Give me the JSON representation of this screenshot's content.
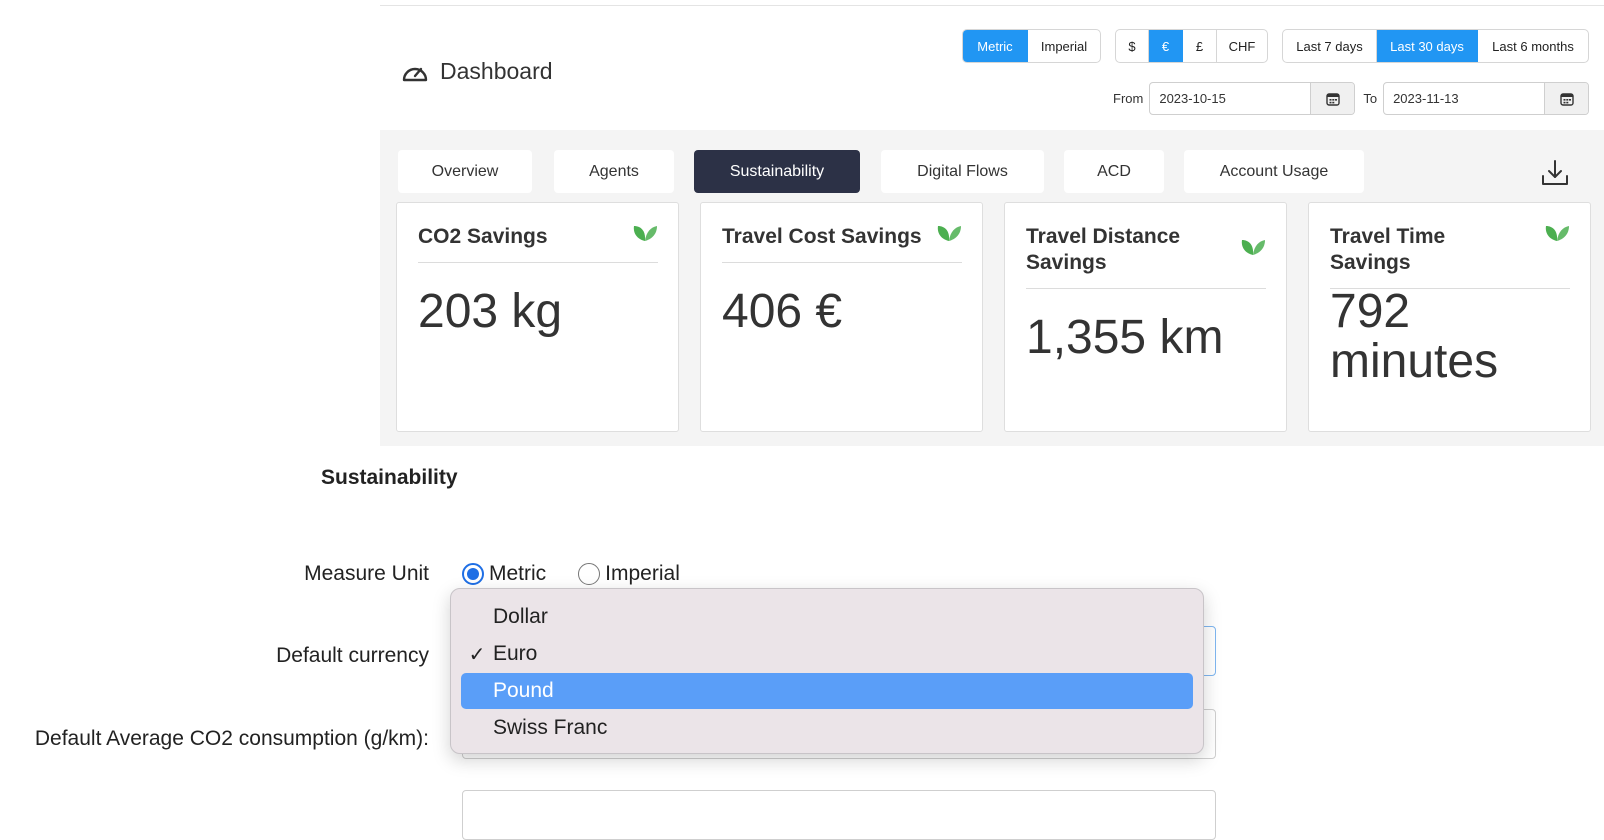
{
  "dashboard": {
    "title": "Dashboard",
    "unit_toggle": [
      {
        "label": "Metric",
        "active": true
      },
      {
        "label": "Imperial",
        "active": false
      }
    ],
    "currency_toggle": [
      {
        "label": "$",
        "active": false
      },
      {
        "label": "€",
        "active": true
      },
      {
        "label": "£",
        "active": false
      },
      {
        "label": "CHF",
        "active": false
      }
    ],
    "range_toggle": [
      {
        "label": "Last 7 days",
        "active": false
      },
      {
        "label": "Last 30 days",
        "active": true
      },
      {
        "label": "Last 6 months",
        "active": false
      }
    ],
    "from_label": "From",
    "from_value": "2023-10-15",
    "to_label": "To",
    "to_value": "2023-11-13",
    "tabs": [
      {
        "label": "Overview",
        "active": false
      },
      {
        "label": "Agents",
        "active": false
      },
      {
        "label": "Sustainability",
        "active": true
      },
      {
        "label": "Digital Flows",
        "active": false
      },
      {
        "label": "ACD",
        "active": false
      },
      {
        "label": "Account Usage",
        "active": false
      }
    ],
    "cards": [
      {
        "title": "CO2 Savings",
        "value": "203 kg"
      },
      {
        "title": "Travel Cost Savings",
        "value": "406 €"
      },
      {
        "title": "Travel Distance Savings",
        "value": "1,355 km"
      },
      {
        "title": "Travel Time Savings",
        "value": "792 minutes"
      }
    ],
    "accent_color": "#2196f3",
    "active_tab_color": "#2c3146",
    "leaf_color": "#4caf50"
  },
  "settings": {
    "section_title": "Sustainability",
    "measure_unit_label": "Measure Unit",
    "measure_options": [
      {
        "label": "Metric",
        "checked": true
      },
      {
        "label": "Imperial",
        "checked": false
      }
    ],
    "currency_label": "Default currency",
    "co2_label": "Default Average CO2 consumption (g/km):"
  },
  "currency_dropdown": {
    "options": [
      {
        "label": "Dollar",
        "selected": false,
        "highlighted": false
      },
      {
        "label": "Euro",
        "selected": true,
        "highlighted": false
      },
      {
        "label": "Pound",
        "selected": false,
        "highlighted": true
      },
      {
        "label": "Swiss Franc",
        "selected": false,
        "highlighted": false
      }
    ],
    "highlight_color": "#5a9ef8"
  }
}
